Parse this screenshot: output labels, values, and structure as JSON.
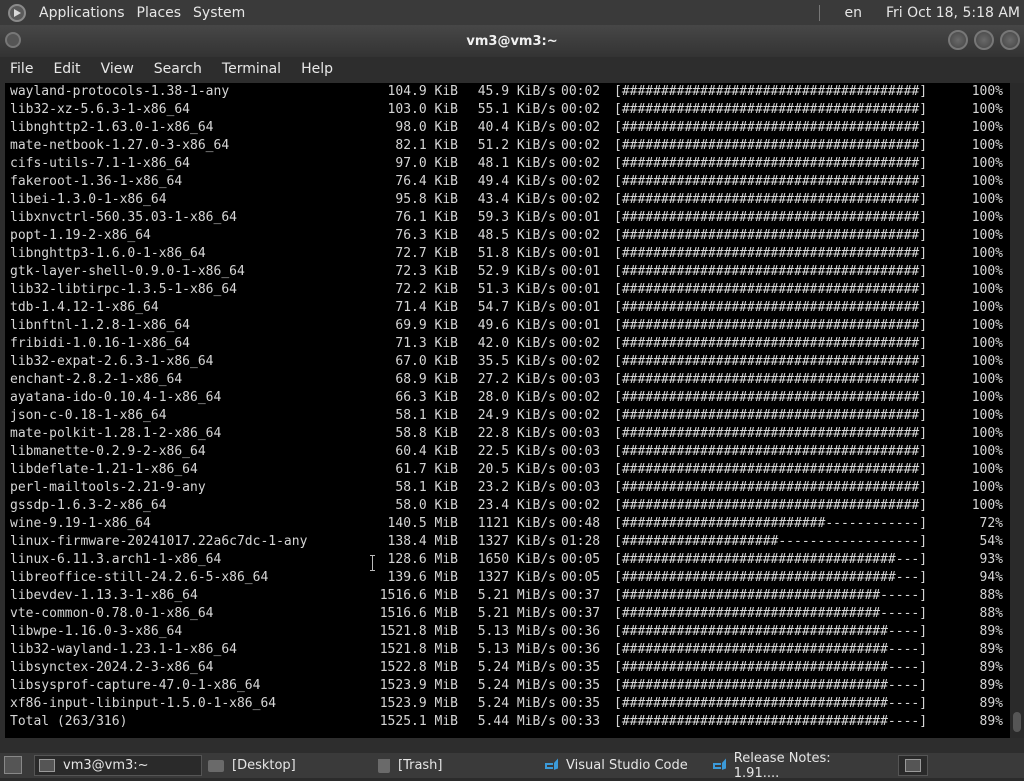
{
  "top_panel": {
    "menus": [
      "Applications",
      "Places",
      "System"
    ],
    "lang": "en",
    "datetime": "Fri Oct 18,  5:18 AM"
  },
  "window": {
    "title": "vm3@vm3:~",
    "menu": [
      "File",
      "Edit",
      "View",
      "Search",
      "Terminal",
      "Help"
    ]
  },
  "terminal": {
    "rows": [
      {
        "name": "wayland-protocols-1.38-1-any",
        "size": "104.9 KiB",
        "speed": "45.9 KiB/s",
        "time": "00:02",
        "bar": "[######################################]",
        "pct": "100%"
      },
      {
        "name": "lib32-xz-5.6.3-1-x86_64",
        "size": "103.0 KiB",
        "speed": "55.1 KiB/s",
        "time": "00:02",
        "bar": "[######################################]",
        "pct": "100%"
      },
      {
        "name": "libnghttp2-1.63.0-1-x86_64",
        "size": "98.0 KiB",
        "speed": "40.4 KiB/s",
        "time": "00:02",
        "bar": "[######################################]",
        "pct": "100%"
      },
      {
        "name": "mate-netbook-1.27.0-3-x86_64",
        "size": "82.1 KiB",
        "speed": "51.2 KiB/s",
        "time": "00:02",
        "bar": "[######################################]",
        "pct": "100%"
      },
      {
        "name": "cifs-utils-7.1-1-x86_64",
        "size": "97.0 KiB",
        "speed": "48.1 KiB/s",
        "time": "00:02",
        "bar": "[######################################]",
        "pct": "100%"
      },
      {
        "name": "fakeroot-1.36-1-x86_64",
        "size": "76.4 KiB",
        "speed": "49.4 KiB/s",
        "time": "00:02",
        "bar": "[######################################]",
        "pct": "100%"
      },
      {
        "name": "libei-1.3.0-1-x86_64",
        "size": "95.8 KiB",
        "speed": "43.4 KiB/s",
        "time": "00:02",
        "bar": "[######################################]",
        "pct": "100%"
      },
      {
        "name": "libxnvctrl-560.35.03-1-x86_64",
        "size": "76.1 KiB",
        "speed": "59.3 KiB/s",
        "time": "00:01",
        "bar": "[######################################]",
        "pct": "100%"
      },
      {
        "name": "popt-1.19-2-x86_64",
        "size": "76.3 KiB",
        "speed": "48.5 KiB/s",
        "time": "00:02",
        "bar": "[######################################]",
        "pct": "100%"
      },
      {
        "name": "libnghttp3-1.6.0-1-x86_64",
        "size": "72.7 KiB",
        "speed": "51.8 KiB/s",
        "time": "00:01",
        "bar": "[######################################]",
        "pct": "100%"
      },
      {
        "name": "gtk-layer-shell-0.9.0-1-x86_64",
        "size": "72.3 KiB",
        "speed": "52.9 KiB/s",
        "time": "00:01",
        "bar": "[######################################]",
        "pct": "100%"
      },
      {
        "name": "lib32-libtirpc-1.3.5-1-x86_64",
        "size": "72.2 KiB",
        "speed": "51.3 KiB/s",
        "time": "00:01",
        "bar": "[######################################]",
        "pct": "100%"
      },
      {
        "name": "tdb-1.4.12-1-x86_64",
        "size": "71.4 KiB",
        "speed": "54.7 KiB/s",
        "time": "00:01",
        "bar": "[######################################]",
        "pct": "100%"
      },
      {
        "name": "libnftnl-1.2.8-1-x86_64",
        "size": "69.9 KiB",
        "speed": "49.6 KiB/s",
        "time": "00:01",
        "bar": "[######################################]",
        "pct": "100%"
      },
      {
        "name": "fribidi-1.0.16-1-x86_64",
        "size": "71.3 KiB",
        "speed": "42.0 KiB/s",
        "time": "00:02",
        "bar": "[######################################]",
        "pct": "100%"
      },
      {
        "name": "lib32-expat-2.6.3-1-x86_64",
        "size": "67.0 KiB",
        "speed": "35.5 KiB/s",
        "time": "00:02",
        "bar": "[######################################]",
        "pct": "100%"
      },
      {
        "name": "enchant-2.8.2-1-x86_64",
        "size": "68.9 KiB",
        "speed": "27.2 KiB/s",
        "time": "00:03",
        "bar": "[######################################]",
        "pct": "100%"
      },
      {
        "name": "ayatana-ido-0.10.4-1-x86_64",
        "size": "66.3 KiB",
        "speed": "28.0 KiB/s",
        "time": "00:02",
        "bar": "[######################################]",
        "pct": "100%"
      },
      {
        "name": "json-c-0.18-1-x86_64",
        "size": "58.1 KiB",
        "speed": "24.9 KiB/s",
        "time": "00:02",
        "bar": "[######################################]",
        "pct": "100%"
      },
      {
        "name": "mate-polkit-1.28.1-2-x86_64",
        "size": "58.8 KiB",
        "speed": "22.8 KiB/s",
        "time": "00:03",
        "bar": "[######################################]",
        "pct": "100%"
      },
      {
        "name": "libmanette-0.2.9-2-x86_64",
        "size": "60.4 KiB",
        "speed": "22.5 KiB/s",
        "time": "00:03",
        "bar": "[######################################]",
        "pct": "100%"
      },
      {
        "name": "libdeflate-1.21-1-x86_64",
        "size": "61.7 KiB",
        "speed": "20.5 KiB/s",
        "time": "00:03",
        "bar": "[######################################]",
        "pct": "100%"
      },
      {
        "name": "perl-mailtools-2.21-9-any",
        "size": "58.1 KiB",
        "speed": "23.2 KiB/s",
        "time": "00:03",
        "bar": "[######################################]",
        "pct": "100%"
      },
      {
        "name": "gssdp-1.6.3-2-x86_64",
        "size": "58.0 KiB",
        "speed": "23.4 KiB/s",
        "time": "00:02",
        "bar": "[######################################]",
        "pct": "100%"
      },
      {
        "name": "wine-9.19-1-x86_64",
        "size": "140.5 MiB",
        "speed": "1121 KiB/s",
        "time": "00:48",
        "bar": "[##########################------------]",
        "pct": "72%"
      },
      {
        "name": "linux-firmware-20241017.22a6c7dc-1-any",
        "size": "138.4 MiB",
        "speed": "1327 KiB/s",
        "time": "01:28",
        "bar": "[####################------------------]",
        "pct": "54%"
      },
      {
        "name": "linux-6.11.3.arch1-1-x86_64",
        "size": "128.6 MiB",
        "speed": "1650 KiB/s",
        "time": "00:05",
        "bar": "[###################################---]",
        "pct": "93%"
      },
      {
        "name": "libreoffice-still-24.2.6-5-x86_64",
        "size": "139.6 MiB",
        "speed": "1327 KiB/s",
        "time": "00:05",
        "bar": "[###################################---]",
        "pct": "94%"
      },
      {
        "name": "libevdev-1.13.3-1-x86_64",
        "size": "1516.6 MiB",
        "speed": "5.21 MiB/s",
        "time": "00:37",
        "bar": "[#################################-----]",
        "pct": "88%"
      },
      {
        "name": "vte-common-0.78.0-1-x86_64",
        "size": "1516.6 MiB",
        "speed": "5.21 MiB/s",
        "time": "00:37",
        "bar": "[#################################-----]",
        "pct": "88%"
      },
      {
        "name": "libwpe-1.16.0-3-x86_64",
        "size": "1521.8 MiB",
        "speed": "5.13 MiB/s",
        "time": "00:36",
        "bar": "[##################################----]",
        "pct": "89%"
      },
      {
        "name": "lib32-wayland-1.23.1-1-x86_64",
        "size": "1521.8 MiB",
        "speed": "5.13 MiB/s",
        "time": "00:36",
        "bar": "[##################################----]",
        "pct": "89%"
      },
      {
        "name": "libsynctex-2024.2-3-x86_64",
        "size": "1522.8 MiB",
        "speed": "5.24 MiB/s",
        "time": "00:35",
        "bar": "[##################################----]",
        "pct": "89%"
      },
      {
        "name": "libsysprof-capture-47.0-1-x86_64",
        "size": "1523.9 MiB",
        "speed": "5.24 MiB/s",
        "time": "00:35",
        "bar": "[##################################----]",
        "pct": "89%"
      },
      {
        "name": "xf86-input-libinput-1.5.0-1-x86_64",
        "size": "1523.9 MiB",
        "speed": "5.24 MiB/s",
        "time": "00:35",
        "bar": "[##################################----]",
        "pct": "89%"
      },
      {
        "name": "Total (263/316)",
        "size": "1525.1 MiB",
        "speed": "5.44 MiB/s",
        "time": "00:33",
        "bar": "[##################################----]",
        "pct": "89%"
      }
    ]
  },
  "taskbar": {
    "items": [
      {
        "label": "vm3@vm3:~",
        "icon": "terminal-icon"
      },
      {
        "label": "[Desktop]",
        "icon": "folder-icon"
      },
      {
        "label": "[Trash]",
        "icon": "trash-icon"
      },
      {
        "label": "Visual Studio Code",
        "icon": "vscode-icon"
      },
      {
        "label": "Release Notes: 1.91....",
        "icon": "vscode-icon"
      }
    ]
  }
}
